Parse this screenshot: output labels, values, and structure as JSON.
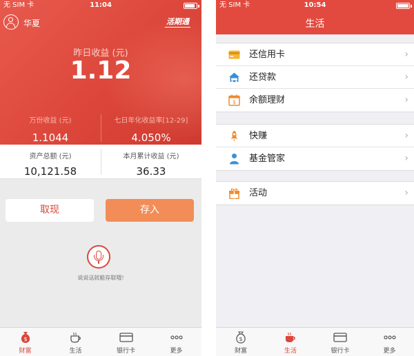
{
  "left": {
    "status": {
      "carrier": "无 SIM 卡",
      "time": "11:04"
    },
    "header": {
      "username": "华夏",
      "brand": "活期通"
    },
    "yesterday_earnings": {
      "label": "昨日收益 (元)",
      "value": "1.12"
    },
    "stats": [
      {
        "label": "万份收益 (元)",
        "value": "1.1044"
      },
      {
        "label": "七日年化收益率[12-29]",
        "value": "4.050%"
      }
    ],
    "summary": [
      {
        "label": "资产总额 (元)",
        "value": "10,121.58"
      },
      {
        "label": "本月累计收益 (元)",
        "value": "36.33"
      }
    ],
    "buttons": {
      "withdraw": "取现",
      "deposit": "存入"
    },
    "voice_hint": "说说话就能存取哦!",
    "tabs": [
      {
        "label": "财富",
        "icon": "money-bag-icon",
        "active": true
      },
      {
        "label": "生活",
        "icon": "coffee-cup-icon",
        "active": false
      },
      {
        "label": "银行卡",
        "icon": "bank-card-icon",
        "active": false
      },
      {
        "label": "更多",
        "icon": "more-dots-icon",
        "active": false
      }
    ]
  },
  "right": {
    "status": {
      "carrier": "无 SIM 卡",
      "time": "10:54"
    },
    "title": "生活",
    "groups": [
      [
        {
          "label": "还信用卡",
          "icon": "credit-card-icon"
        },
        {
          "label": "还贷款",
          "icon": "house-car-icon"
        },
        {
          "label": "余额理财",
          "icon": "calendar-money-icon"
        }
      ],
      [
        {
          "label": "快赚",
          "icon": "rocket-icon"
        },
        {
          "label": "基金管家",
          "icon": "person-icon"
        }
      ],
      [
        {
          "label": "活动",
          "icon": "gift-icon"
        }
      ]
    ],
    "tabs": [
      {
        "label": "财富",
        "icon": "money-bag-icon",
        "active": false
      },
      {
        "label": "生活",
        "icon": "coffee-cup-icon",
        "active": true
      },
      {
        "label": "银行卡",
        "icon": "bank-card-icon",
        "active": false
      },
      {
        "label": "更多",
        "icon": "more-dots-icon",
        "active": false
      }
    ]
  },
  "colors": {
    "brand_red": "#e34a3f",
    "deposit_orange": "#f38d57",
    "icon_orange": "#f08a2c",
    "icon_blue": "#3a8fd9"
  }
}
